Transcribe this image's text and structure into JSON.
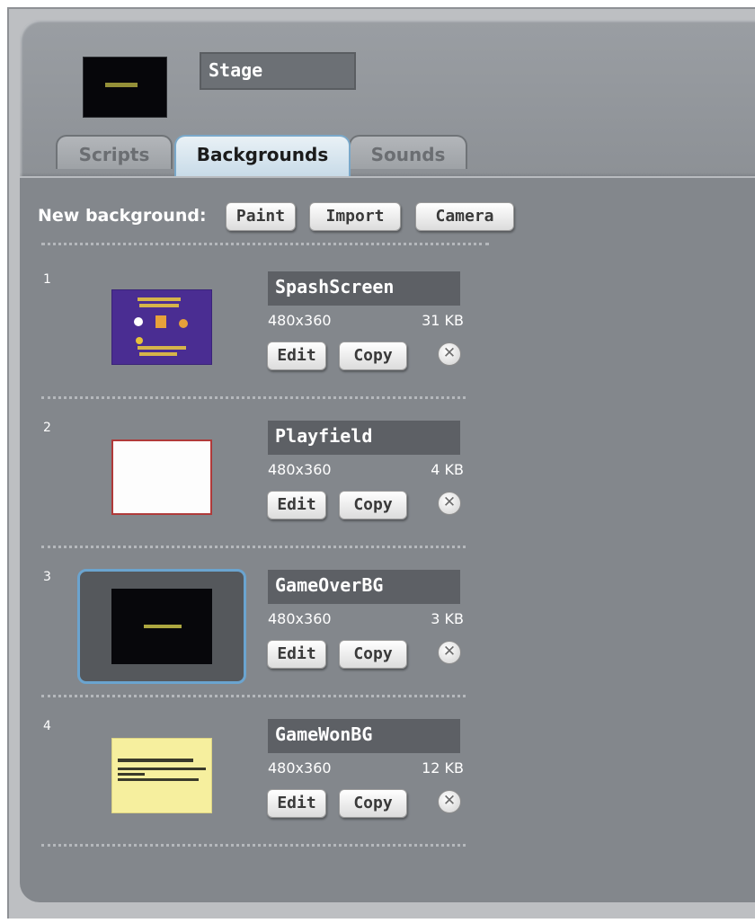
{
  "sprite": {
    "name": "Stage"
  },
  "tabs": [
    {
      "label": "Scripts",
      "active": false
    },
    {
      "label": "Backgrounds",
      "active": true
    },
    {
      "label": "Sounds",
      "active": false
    }
  ],
  "new_background": {
    "label": "New background:",
    "buttons": [
      "Paint",
      "Import",
      "Camera"
    ]
  },
  "costume_buttons": {
    "edit": "Edit",
    "copy": "Copy",
    "delete_icon": "close-icon"
  },
  "costumes": [
    {
      "number": "1",
      "name": "SpashScreen",
      "dimensions": "480x360",
      "size": "31 KB",
      "thumb_color": "#4a2d92",
      "selected": false
    },
    {
      "number": "2",
      "name": "Playfield",
      "dimensions": "480x360",
      "size": "4 KB",
      "thumb_color": "#fdfdfd",
      "selected": false
    },
    {
      "number": "3",
      "name": "GameOverBG",
      "dimensions": "480x360",
      "size": "3 KB",
      "thumb_color": "#07070b",
      "selected": true
    },
    {
      "number": "4",
      "name": "GameWonBG",
      "dimensions": "480x360",
      "size": "12 KB",
      "thumb_color": "#f6ef9e",
      "selected": false
    }
  ],
  "colors": {
    "selection": "#6ba4cf",
    "active_tab": "#c8dbe8",
    "panel": "#83878c"
  }
}
